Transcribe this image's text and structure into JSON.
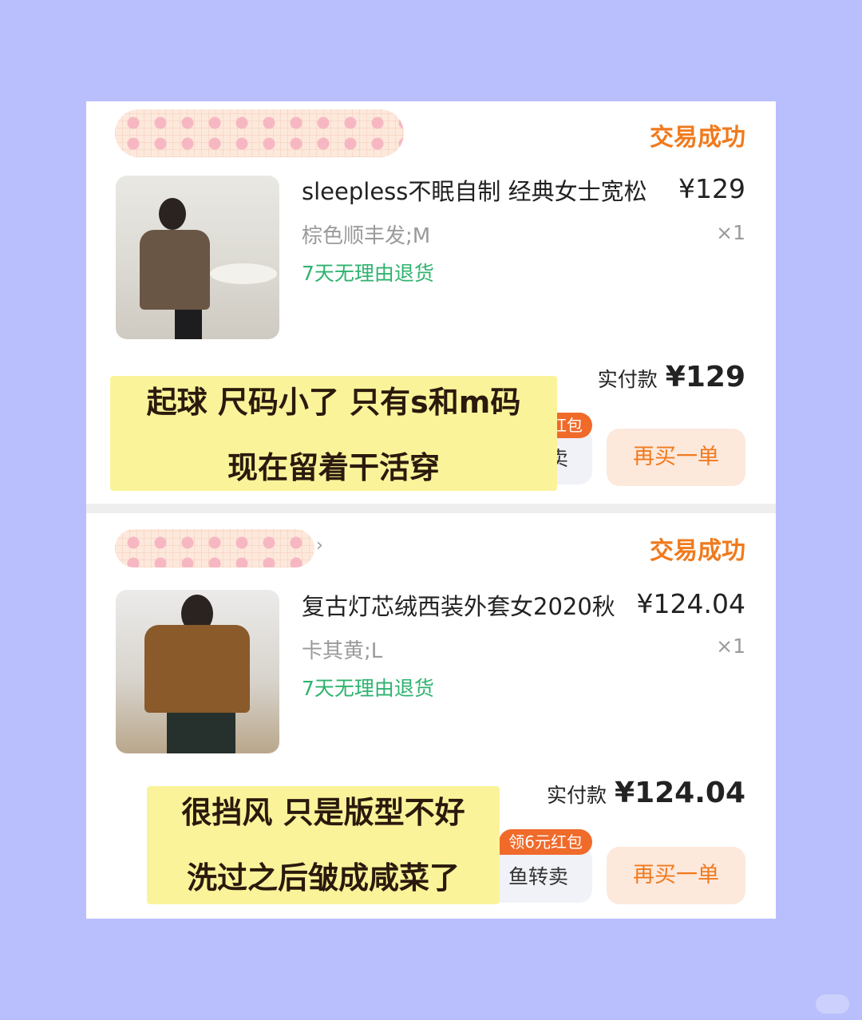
{
  "orders": [
    {
      "status": "交易成功",
      "product_title": "sleepless不眠自制 经典女士宽松",
      "price": "¥129",
      "spec": "棕色顺丰发;M",
      "quantity": "×1",
      "return_policy": "7天无理由退货",
      "paid_label": "实付款",
      "paid_amount": "¥129",
      "coupon_badge": "红包",
      "resell_label": "卖",
      "rebuy_label": "再买一单",
      "note_lines": [
        "起球 尺码小了 只有s和m码",
        "现在留着干活穿"
      ]
    },
    {
      "status": "交易成功",
      "product_title": "复古灯芯绒西装外套女2020秋",
      "price": "¥124.04",
      "spec": "卡其黄;L",
      "quantity": "×1",
      "return_policy": "7天无理由退货",
      "paid_label": "实付款",
      "paid_amount": "¥124.04",
      "coupon_badge": "领6元红包",
      "resell_label": "鱼转卖",
      "rebuy_label": "再买一单",
      "note_lines": [
        "很挡风 只是版型不好",
        "洗过之后皱成咸菜了"
      ]
    }
  ],
  "colors": {
    "page_background": "#b9bffc",
    "status": "#f07a1d",
    "return_policy": "#2fb36f",
    "note_highlight": "#fbf39a",
    "coupon": "#f06a2a"
  },
  "icons": {
    "shop_arrow": "chevron-right-icon"
  }
}
